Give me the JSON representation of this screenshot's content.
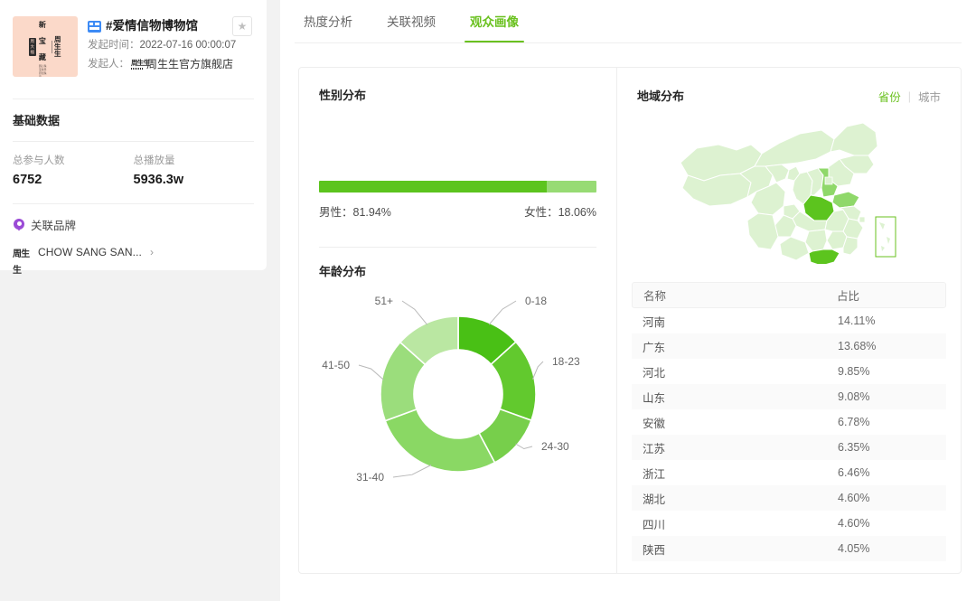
{
  "campaign": {
    "platform_badge": "douyin-badge-icon",
    "title": "#爱情信物博物馆",
    "star_icon": "★",
    "start_time_label": "发起时间：",
    "start_time_value": "2022-07-16 00:00:07",
    "initiator_label": "发起人：",
    "initiator_value": "周生生官方旗舰店",
    "thumb_logo_block": "周大福",
    "thumb_logo_text": "新宝藏",
    "thumb_logo_sub": "圆心珠宝世界原创珠宝",
    "thumb_logo_right": "周生生",
    "basic_section_title": "基础数据",
    "stats": [
      {
        "label": "总参与人数",
        "value": "6752"
      },
      {
        "label": "总播放量",
        "value": "5936.3w"
      }
    ],
    "brand_section_title": "关联品牌",
    "brand_logo_text": "周生生",
    "brand_name": "CHOW SANG SAN...",
    "brand_chevron": "›"
  },
  "tabs": [
    {
      "label": "热度分析",
      "active": false
    },
    {
      "label": "关联视频",
      "active": false
    },
    {
      "label": "观众画像",
      "active": true
    }
  ],
  "gender": {
    "title": "性别分布",
    "male_label": "男性：",
    "male_value": "81.94%",
    "female_label": "女性：",
    "female_value": "18.06%",
    "male_pct": 81.94,
    "female_pct": 18.06,
    "male_color": "#5cc41e",
    "female_color": "#97db74"
  },
  "region": {
    "title": "地域分布",
    "toggle": [
      {
        "label": "省份",
        "active": true
      },
      {
        "label": "城市",
        "active": false
      }
    ],
    "map_base_color": "#ddf2d1",
    "map_highlight_color": "#5cc41e",
    "map_mid_color": "#8fd86a",
    "table": {
      "columns": [
        "名称",
        "占比"
      ],
      "rows": [
        {
          "name": "河南",
          "pct": "14.11%"
        },
        {
          "name": "广东",
          "pct": "13.68%"
        },
        {
          "name": "河北",
          "pct": "9.85%"
        },
        {
          "name": "山东",
          "pct": "9.08%"
        },
        {
          "name": "安徽",
          "pct": "6.78%"
        },
        {
          "name": "江苏",
          "pct": "6.35%"
        },
        {
          "name": "浙江",
          "pct": "6.46%"
        },
        {
          "name": "湖北",
          "pct": "4.60%"
        },
        {
          "name": "四川",
          "pct": "4.60%"
        },
        {
          "name": "陕西",
          "pct": "4.05%"
        }
      ]
    }
  },
  "chart_data": {
    "type": "pie",
    "title": "年龄分布",
    "donut": true,
    "legend": "callout-labels",
    "categories": [
      "0-18",
      "18-23",
      "24-30",
      "31-40",
      "41-50",
      "51+"
    ],
    "values": [
      13.3,
      17.2,
      11.7,
      27.2,
      17.2,
      13.4
    ],
    "colors": [
      "#49c015",
      "#62c92e",
      "#77cf4b",
      "#8ad864",
      "#9bdd7c",
      "#bae7a2"
    ],
    "start_angle_deg": 0,
    "unit": "%"
  }
}
